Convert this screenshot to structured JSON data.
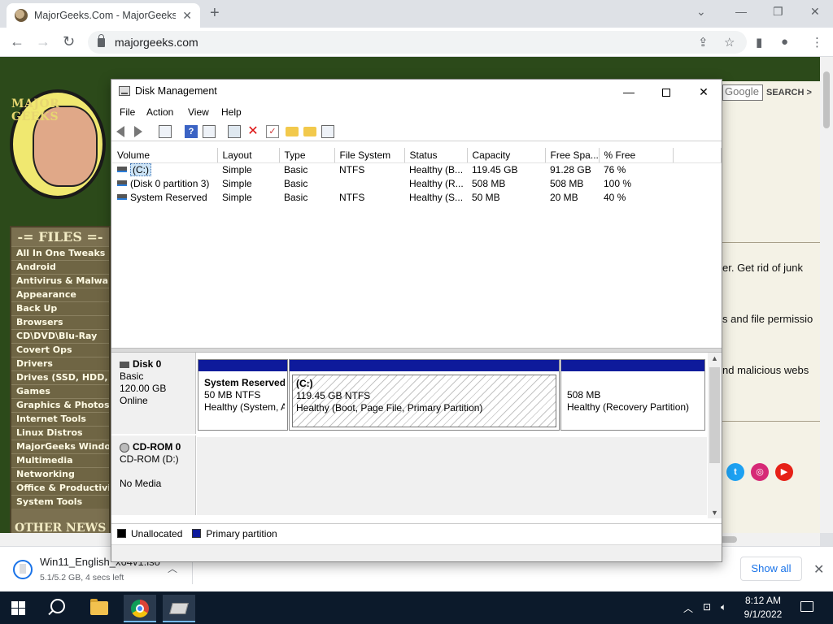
{
  "browser": {
    "tab_title": "MajorGeeks.Com - MajorGeeks",
    "url": "majorgeeks.com",
    "tab_icon": "majorgeeks-favicon",
    "colors": {
      "tabstrip": "#dee1e6",
      "omnibox": "#f1f3f4"
    }
  },
  "website": {
    "logo_text": "MAJOR GEEKS",
    "files_heading": "-= FILES =-",
    "categories": [
      "All In One Tweaks",
      "Android",
      "Antivirus & Malware",
      "Appearance",
      "Back Up",
      "Browsers",
      "CD\\DVD\\Blu-Ray",
      "Covert Ops",
      "Drivers",
      "Drives (SSD, HDD, USB)",
      "Games",
      "Graphics & Photos",
      "Internet Tools",
      "Linux Distros",
      "MajorGeeks Windows Tweaks",
      "Multimedia",
      "Networking",
      "Office & Productivity",
      "System Tools"
    ],
    "other_heading": "OTHER NEWS",
    "search_placeholder": "Google",
    "search_button": "SEARCH >",
    "snippets": [
      "er. Get rid of junk",
      "s and file permissio",
      "nd malicious webs"
    ],
    "colors": {
      "sidebar": "#6f6544",
      "sidebar_text": "#fffbe4",
      "background": "#2c4a1a"
    }
  },
  "download_bar": {
    "file_name": "Win11_English_x64v1.iso",
    "status": "5.1/5.2 GB, 4 secs left",
    "show_all": "Show all"
  },
  "taskbar": {
    "time": "8:12 AM",
    "date": "9/1/2022",
    "colors": {
      "bar": "#0c1a2b",
      "active_indicator": "#76b9ed"
    }
  },
  "disk_management": {
    "title": "Disk Management",
    "menus": [
      "File",
      "Action",
      "View",
      "Help"
    ],
    "columns": [
      "Volume",
      "Layout",
      "Type",
      "File System",
      "Status",
      "Capacity",
      "Free Spa...",
      "% Free"
    ],
    "volumes": [
      {
        "volume": "(C:)",
        "layout": "Simple",
        "type": "Basic",
        "fs": "NTFS",
        "status": "Healthy (B...",
        "capacity": "119.45 GB",
        "free": "91.28 GB",
        "pct": "76 %"
      },
      {
        "volume": "(Disk 0 partition 3)",
        "layout": "Simple",
        "type": "Basic",
        "fs": "",
        "status": "Healthy (R...",
        "capacity": "508 MB",
        "free": "508 MB",
        "pct": "100 %"
      },
      {
        "volume": "System Reserved",
        "layout": "Simple",
        "type": "Basic",
        "fs": "NTFS",
        "status": "Healthy (S...",
        "capacity": "50 MB",
        "free": "20 MB",
        "pct": "40 %"
      }
    ],
    "disks": [
      {
        "name": "Disk 0",
        "kind": "Basic",
        "size": "120.00 GB",
        "state": "Online"
      },
      {
        "name": "CD-ROM 0",
        "kind": "CD-ROM (D:)",
        "size": "",
        "state": "No Media"
      }
    ],
    "partitions": [
      {
        "name": "System Reserved",
        "size": "50 MB NTFS",
        "status": "Healthy (System, Active, Primary Partition)"
      },
      {
        "name": "(C:)",
        "size": "119.45 GB NTFS",
        "status": "Healthy (Boot, Page File, Primary Partition)"
      },
      {
        "name": "",
        "size": "508 MB",
        "status": "Healthy (Recovery Partition)"
      }
    ],
    "legend": [
      "Unallocated",
      "Primary partition"
    ],
    "colors": {
      "primary_partition": "#0e1a9b",
      "unallocated": "#000000",
      "selection": "#cce4f7"
    }
  }
}
